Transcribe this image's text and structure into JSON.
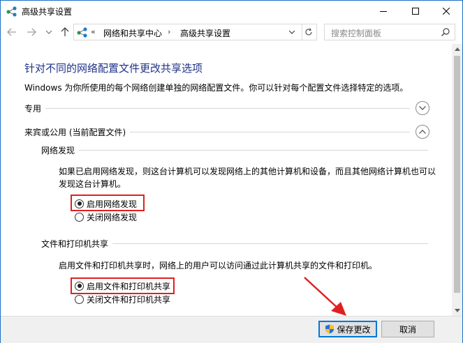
{
  "window": {
    "title": "高级共享设置",
    "icon": "network-icon"
  },
  "nav": {
    "chevrons": "«",
    "crumbs": [
      "网络和共享中心",
      "高级共享设置"
    ],
    "separator": "›",
    "search_placeholder": "搜索控制面板"
  },
  "content": {
    "heading": "针对不同的网络配置文件更改共享选项",
    "description": "Windows 为你所使用的每个网络创建单独的网络配置文件。你可以针对每个配置文件选择特定的选项。",
    "profiles": [
      {
        "label": "专用",
        "expanded": false
      },
      {
        "label": "来宾或公用 (当前配置文件)",
        "expanded": true
      }
    ],
    "network_discovery": {
      "title": "网络发现",
      "text": "如果已启用网络发现，则这台计算机可以发现网络上的其他计算机和设备，而且其他网络计算机也可以发现这台计算机。",
      "options": [
        "启用网络发现",
        "关闭网络发现"
      ],
      "selected": "启用网络发现"
    },
    "file_printer_sharing": {
      "title": "文件和打印机共享",
      "text": "启用文件和打印机共享时，网络上的用户可以访问通过此计算机共享的文件和打印机。",
      "options": [
        "启用文件和打印机共享",
        "关闭文件和打印机共享"
      ],
      "selected": "启用文件和打印机共享"
    }
  },
  "footer": {
    "save_label": "保存更改",
    "cancel_label": "取消"
  },
  "colors": {
    "heading": "#1e3287",
    "highlight": "#e02020",
    "accent": "#0078d7"
  }
}
